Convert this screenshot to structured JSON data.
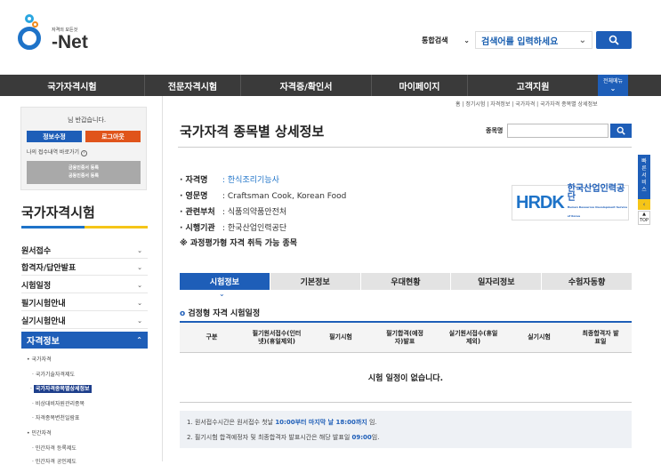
{
  "header": {
    "tagline": "자격의 모든것",
    "logo_text": "Net",
    "search_select": "통합검색",
    "search_placeholder": "검색어를 입력하세요"
  },
  "nav": {
    "items": [
      "국가자격시험",
      "전문자격시험",
      "자격증/확인서",
      "마이페이지",
      "고객지원"
    ],
    "all_menu": "전체메뉴"
  },
  "login": {
    "greeting": "님 반갑습니다.",
    "info_button": "정보수정",
    "logout_button": "로그아웃",
    "shortcut": "나의 접수내역 바로가기",
    "cert1": "금융인증서 등록",
    "cert2": "공동인증서 등록"
  },
  "sidebar": {
    "title": "국가자격시험",
    "menu": [
      "원서접수",
      "합격자/답안발표",
      "시험일정",
      "필기시험안내",
      "실기시험안내"
    ],
    "active": "자격정보",
    "sub": [
      {
        "label": "국가자격",
        "level": 1
      },
      {
        "label": "국가기술자격제도",
        "level": 2
      },
      {
        "label": "국가자격종목별상세정보",
        "level": 2
      },
      {
        "label": "비상대비자원관리종목",
        "level": 2
      },
      {
        "label": "자격종목변천일람표",
        "level": 2
      },
      {
        "label": "민간자격",
        "level": 1
      },
      {
        "label": "민간자격 등록제도",
        "level": 2
      },
      {
        "label": "민간자격 공인제도",
        "level": 2
      }
    ]
  },
  "content": {
    "breadcrumb": "홈 | 정기시험 | 자격정보 | 국가자격 | 국가자격 종목별 상세정보",
    "title": "국가자격 종목별 상세정보",
    "search_label": "종목명",
    "info": [
      {
        "key": "· 자격명",
        "value": ": 한식조리기능사",
        "link": true
      },
      {
        "key": "· 영문명",
        "value": ": Craftsman Cook, Korean Food",
        "link": false
      },
      {
        "key": "· 관련부처",
        "value": ": 식품의약품안전처",
        "link": false
      },
      {
        "key": "· 시행기관",
        "value": ": 한국산업인력공단",
        "link": false
      }
    ],
    "process_note": "※ 과정평가형 자격 취득 가능 종목",
    "org_logo": {
      "mark": "HRDK",
      "name": "한국산업인력공단",
      "sub": "Human Resources Development Service of Korea"
    },
    "tabs": [
      "시험정보",
      "기본정보",
      "우대현황",
      "일자리정보",
      "수험자동향"
    ],
    "active_tab": 0,
    "section_title": "검정형 자격 시험일정",
    "table_headers": [
      "구분",
      "필기원서접수(인터넷)(휴일제외)",
      "필기시험",
      "필기합격(예정자)발표",
      "실기원서접수(휴일제외)",
      "실기시험",
      "최종합격자 발표일"
    ],
    "empty_message": "시험 일정이 없습니다.",
    "notes": {
      "n1_pre": "1. 원서접수시간은 원서접수 첫날 ",
      "n1_hl": "10:00부터 마지막 날 18:00까지",
      "n1_post": " 임.",
      "n2_pre": "2. 필기시험 합격예정자 및 최종합격자 발표시간은 해당 발표일 ",
      "n2_hl": "09:00",
      "n2_post": "임."
    }
  },
  "side": {
    "quick": "빠른서비스",
    "top": "TOP"
  },
  "colors": {
    "primary": "#1e5eb8",
    "accent": "#e0541b",
    "nav_bg": "#3a3a3a"
  }
}
